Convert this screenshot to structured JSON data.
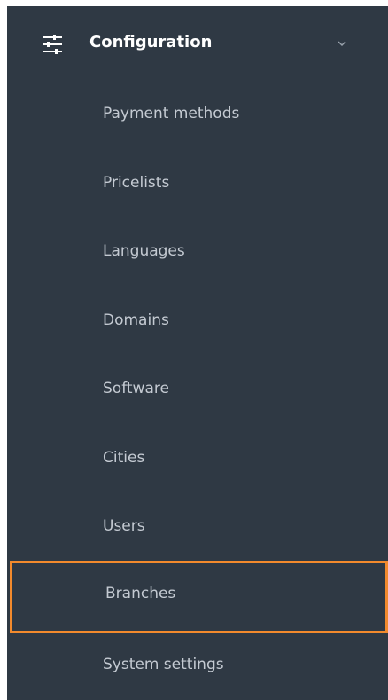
{
  "sidebar": {
    "group": {
      "title": "Configuration",
      "icon": "sliders-icon",
      "expanded_icon": "chevron-down-icon"
    },
    "items": [
      {
        "label": "Payment methods"
      },
      {
        "label": "Pricelists"
      },
      {
        "label": "Languages"
      },
      {
        "label": "Domains"
      },
      {
        "label": "Software"
      },
      {
        "label": "Cities"
      },
      {
        "label": "Users"
      },
      {
        "label": "Branches",
        "highlighted": true
      },
      {
        "label": "System settings"
      }
    ]
  },
  "colors": {
    "background": "#2f3944",
    "text": "#c4cad2",
    "title": "#ffffff",
    "highlight_border": "#f28a2d"
  }
}
